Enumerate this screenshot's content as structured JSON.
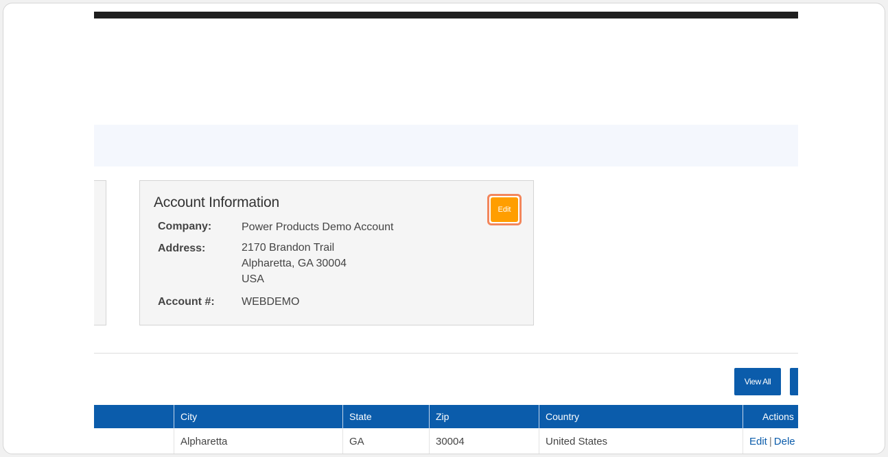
{
  "account_card": {
    "title": "Account Information",
    "edit_label": "Edit",
    "company_label": "Company:",
    "company_value": "Power Products Demo Account",
    "address_label": "Address:",
    "address_line1": "2170 Brandon Trail",
    "address_line2": "Alpharetta, GA 30004",
    "address_line3": "USA",
    "account_label": "Account #:",
    "account_value": "WEBDEMO"
  },
  "toolbar": {
    "view_all_label": "View All"
  },
  "table": {
    "headers": [
      "City",
      "State",
      "Zip",
      "Country",
      "Actions"
    ],
    "rows": [
      {
        "city": "Alpharetta",
        "state": "GA",
        "zip": "30004",
        "country": "United States",
        "edit": "Edit",
        "sep": "|",
        "delete": "Dele"
      }
    ]
  },
  "colors": {
    "header_blue": "#0b5cab",
    "edit_orange": "#ff9e00",
    "highlight": "#f3865b"
  }
}
